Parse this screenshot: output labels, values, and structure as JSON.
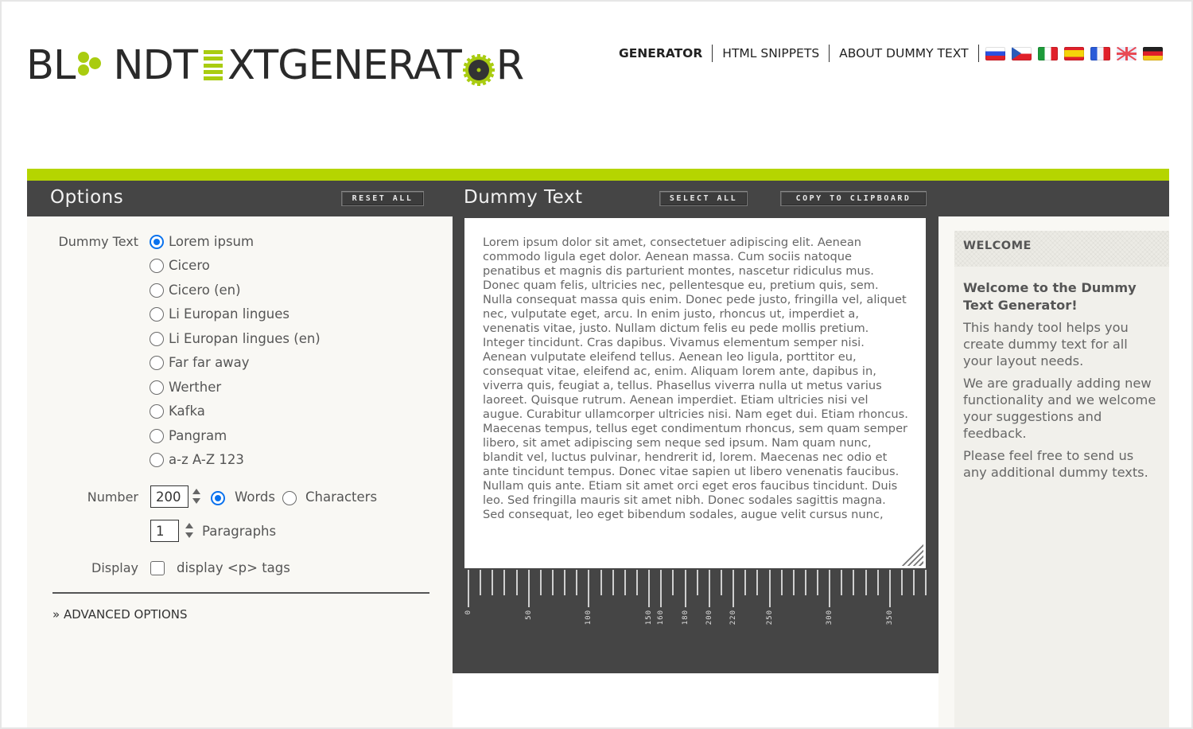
{
  "logo": {
    "text_left": "BL",
    "text_mid": "NDT",
    "text_right": "XTGENERAT",
    "text_end": "R",
    "alt": "BLINDTEXTGENERATOR",
    "accent_color": "#a9cc10"
  },
  "nav": {
    "items": [
      {
        "label": "GENERATOR",
        "active": true
      },
      {
        "label": "HTML SNIPPETS",
        "active": false
      },
      {
        "label": "ABOUT DUMMY TEXT",
        "active": false
      }
    ],
    "flags": [
      "russian",
      "czech",
      "italian",
      "spanish",
      "french",
      "english",
      "german"
    ]
  },
  "colors": {
    "accent_green": "#b5d500",
    "header_dark": "#454545",
    "radio_blue": "#0a72ee"
  },
  "options": {
    "title": "Options",
    "reset_label": "RESET ALL",
    "dummy_text_label": "Dummy Text",
    "text_types": [
      {
        "label": "Lorem ipsum",
        "selected": true
      },
      {
        "label": "Cicero",
        "selected": false
      },
      {
        "label": "Cicero (en)",
        "selected": false
      },
      {
        "label": "Li Europan lingues",
        "selected": false
      },
      {
        "label": "Li Europan lingues (en)",
        "selected": false
      },
      {
        "label": "Far far away",
        "selected": false
      },
      {
        "label": "Werther",
        "selected": false
      },
      {
        "label": "Kafka",
        "selected": false
      },
      {
        "label": "Pangram",
        "selected": false
      },
      {
        "label": "a-z A-Z 123",
        "selected": false
      }
    ],
    "number_label": "Number",
    "number_value": "200",
    "unit_words": "Words",
    "unit_characters": "Characters",
    "unit_selected": "Words",
    "paragraphs_value": "1",
    "paragraphs_label": "Paragraphs",
    "display_label": "Display",
    "display_p_tags_label": "display <p> tags",
    "display_p_tags_checked": false,
    "advanced_label": "» ADVANCED OPTIONS"
  },
  "dummy": {
    "title": "Dummy Text",
    "select_all_label": "SELECT ALL",
    "copy_label": "COPY TO CLIPBOARD",
    "text": "Lorem ipsum dolor sit amet, consectetuer adipiscing elit. Aenean commodo ligula eget dolor. Aenean massa. Cum sociis natoque penatibus et magnis dis parturient montes, nascetur ridiculus mus. Donec quam felis, ultricies nec, pellentesque eu, pretium quis, sem. Nulla consequat massa quis enim. Donec pede justo, fringilla vel, aliquet nec, vulputate eget, arcu. In enim justo, rhoncus ut, imperdiet a, venenatis vitae, justo. Nullam dictum felis eu pede mollis pretium. Integer tincidunt. Cras dapibus. Vivamus elementum semper nisi. Aenean vulputate eleifend tellus. Aenean leo ligula, porttitor eu, consequat vitae, eleifend ac, enim. Aliquam lorem ante, dapibus in, viverra quis, feugiat a, tellus. Phasellus viverra nulla ut metus varius laoreet. Quisque rutrum. Aenean imperdiet. Etiam ultricies nisi vel augue. Curabitur ullamcorper ultricies nisi. Nam eget dui. Etiam rhoncus. Maecenas tempus, tellus eget condimentum rhoncus, sem quam semper libero, sit amet adipiscing sem neque sed ipsum. Nam quam nunc, blandit vel, luctus pulvinar, hendrerit id, lorem. Maecenas nec odio et ante tincidunt tempus. Donec vitae sapien ut libero venenatis faucibus. Nullam quis ante. Etiam sit amet orci eget eros faucibus tincidunt. Duis leo. Sed fringilla mauris sit amet nibh. Donec sodales sagittis magna. Sed consequat, leo eget bibendum sodales, augue velit cursus nunc,",
    "ruler_labels": [
      "0",
      "50",
      "100",
      "150",
      "160",
      "180",
      "200",
      "220",
      "250",
      "300",
      "350"
    ],
    "ruler_max": 380,
    "ruler_minor_step": 10
  },
  "sidebar": {
    "header": "WELCOME",
    "heading": "Welcome to the Dummy Text Generator!",
    "paragraphs": [
      "This handy tool helps you create dummy text for all your layout needs.",
      "We are gradually adding new functionality and we welcome your suggestions and feedback.",
      "Please feel free to send us any additional dummy texts."
    ]
  }
}
